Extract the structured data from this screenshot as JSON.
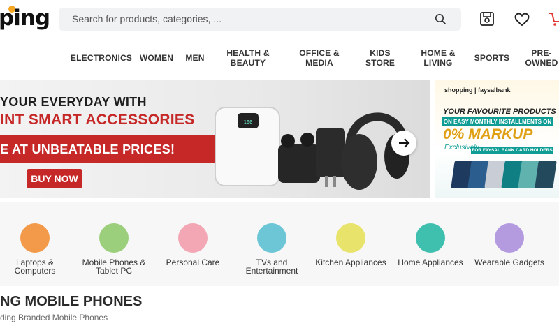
{
  "header": {
    "logo_text": "ping",
    "search_placeholder": "Search for products, categories, ...",
    "icons": [
      "save-for-later-icon",
      "heart-icon",
      "cart-icon"
    ]
  },
  "nav": {
    "items": [
      {
        "label": "ELECTRONICS"
      },
      {
        "label": "WOMEN"
      },
      {
        "label": "MEN"
      },
      {
        "label": "HEALTH & BEAUTY"
      },
      {
        "label": "OFFICE & MEDIA"
      },
      {
        "label": "KIDS STORE"
      },
      {
        "label": "HOME & LIVING"
      },
      {
        "label": "SPORTS"
      },
      {
        "label": "PRE-OWNED"
      }
    ]
  },
  "banner": {
    "line1": "YOUR EVERYDAY WITH",
    "line2": "INT SMART ACCESSORIES",
    "line3": "E AT UNBEATABLE PRICES!",
    "cta": "BUY NOW",
    "colors": {
      "accent": "#c62828"
    }
  },
  "side_banner": {
    "brand": "shopping | faysalbank",
    "line1": "YOUR FAVOURITE PRODUCTS",
    "line2": "ON EASY MONTHLY INSTALLMENTS ON",
    "line3": "0% MARKUP",
    "line4": "Exclusively",
    "line5": "FOR FAYSAL BANK CARD HOLDERS"
  },
  "categories": [
    {
      "label": "Laptops & Computers",
      "color": "#f39a4a"
    },
    {
      "label": "Mobile Phones & Tablet PC",
      "color": "#9ccf7c"
    },
    {
      "label": "Personal Care",
      "color": "#f3a6b3"
    },
    {
      "label": "TVs and Entertainment",
      "color": "#6cc6d6"
    },
    {
      "label": "Kitchen Appliances",
      "color": "#e8e36a"
    },
    {
      "label": "Home Appliances",
      "color": "#3fbfae"
    },
    {
      "label": "Wearable Gadgets",
      "color": "#b49be0"
    }
  ],
  "section": {
    "title": "NG MOBILE PHONES",
    "subtitle": "ding Branded Mobile Phones"
  }
}
